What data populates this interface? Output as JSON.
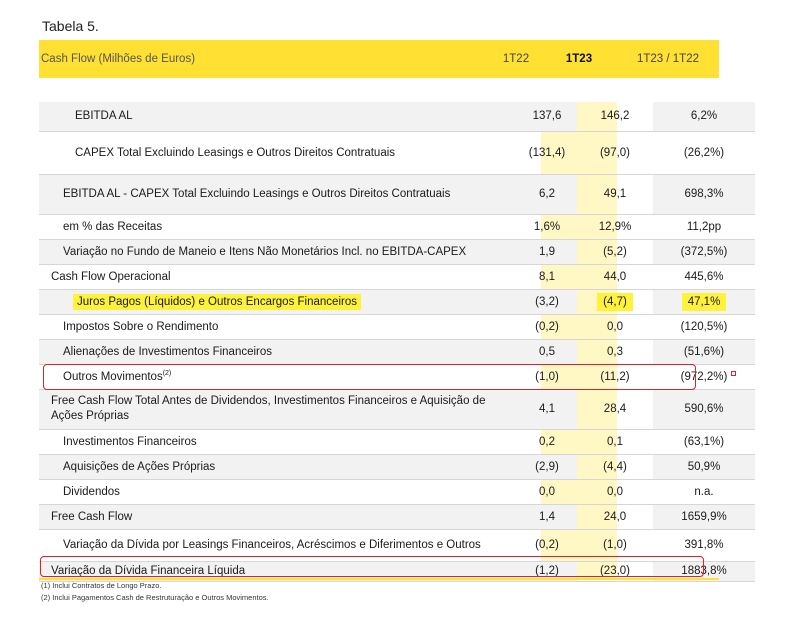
{
  "caption": "Tabela 5.",
  "header": {
    "label": "Cash Flow (Milhões de Euros)",
    "col1": "1T22",
    "col2": "1T23",
    "col3": "1T23 / 1T22"
  },
  "rows": [
    {
      "label": "EBITDA AL",
      "c1": "137,6",
      "c2": "146,2",
      "c3": "6,2%"
    },
    {
      "label": "CAPEX Total Excluindo Leasings e Outros Direitos Contratuais",
      "c1": "(131,4)",
      "c2": "(97,0)",
      "c3": "(26,2%)"
    },
    {
      "label": "EBITDA AL - CAPEX Total Excluindo Leasings e Outros Direitos Contratuais",
      "c1": "6,2",
      "c2": "49,1",
      "c3": "698,3%"
    },
    {
      "label": "em % das Receitas",
      "c1": "1,6%",
      "c2": "12,9%",
      "c3": "11,2pp"
    },
    {
      "label": "Variação no Fundo de Maneio e Itens Não Monetários Incl. no EBITDA-CAPEX",
      "c1": "1,9",
      "c2": "(5,2)",
      "c3": "(372,5%)"
    },
    {
      "label": "Cash Flow Operacional",
      "c1": "8,1",
      "c2": "44,0",
      "c3": "445,6%"
    },
    {
      "label": "Juros Pagos (Líquidos) e Outros Encargos Financeiros",
      "c1": "(3,2)",
      "c2": "(4,7)",
      "c3": "47,1%"
    },
    {
      "label": "Impostos Sobre o Rendimento",
      "c1": "(0,2)",
      "c2": "0,0",
      "c3": "(120,5%)"
    },
    {
      "label": "Alienações de Investimentos Financeiros",
      "c1": "0,5",
      "c2": "0,3",
      "c3": "(51,6%)"
    },
    {
      "label": "Outros Movimentos",
      "sup": "(2)",
      "c1": "(1,0)",
      "c2": "(11,2)",
      "c3": "(972,2%)"
    },
    {
      "label": "Free Cash Flow Total Antes de Dividendos, Investimentos Financeiros e Aquisição de Ações Próprias",
      "c1": "4,1",
      "c2": "28,4",
      "c3": "590,6%"
    },
    {
      "label": "Investimentos Financeiros",
      "c1": "0,2",
      "c2": "0,1",
      "c3": "(63,1%)"
    },
    {
      "label": "Aquisições de Ações Próprias",
      "c1": "(2,9)",
      "c2": "(4,4)",
      "c3": "50,9%"
    },
    {
      "label": "Dividendos",
      "c1": "0,0",
      "c2": "0,0",
      "c3": "n.a."
    },
    {
      "label": "Free Cash Flow",
      "c1": "1,4",
      "c2": "24,0",
      "c3": "1659,9%"
    },
    {
      "label": "Variação da Dívida por Leasings Financeiros, Acréscimos e Diferimentos e Outros",
      "c1": "(0,2)",
      "c2": "(1,0)",
      "c3": "391,8%"
    },
    {
      "label": "Variação da Dívida Financeira Líquida",
      "c1": "(1,2)",
      "c2": "(23,0)",
      "c3": "1883,8%"
    }
  ],
  "notes": [
    "(1) Inclui Contratos de Longo Prazo.",
    "(2) Inclui Pagamentos Cash de Restruturação e Outros Movimentos."
  ],
  "colors": {
    "header_yellow": "#ffe033",
    "column_highlight": "#fff7c4",
    "marker_yellow": "#fff23a",
    "annotation_red": "#d0262d"
  }
}
